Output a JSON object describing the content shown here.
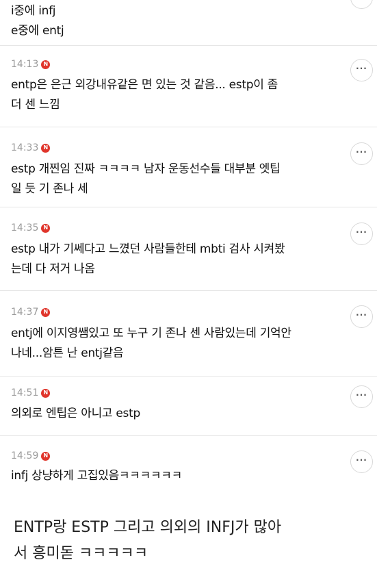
{
  "comments": [
    {
      "time": "",
      "text": "i중에 infj\ne중에 entj",
      "more": "···"
    },
    {
      "time": "14:13",
      "text": "entp은 은근 외강내유같은 면 있는 것 같음... estp이 좀\n더 센 느낌",
      "more": "···"
    },
    {
      "time": "14:33",
      "text": "estp 개찐임 진짜 ㅋㅋㅋㅋ 남자 운동선수들 대부분 엣팁\n일 듯 기 존나 세",
      "more": "···"
    },
    {
      "time": "14:35",
      "text": "estp 내가 기쎄다고 느꼈던 사람들한테 mbti 검사 시켜봤\n는데 다 저거 나옴",
      "more": "···"
    },
    {
      "time": "14:37",
      "text": "entj에 이지영쌤있고 또 누구 기 존나 센 사람있는데 기억안\n나네...암튼 난 entj같음",
      "more": "···"
    },
    {
      "time": "14:51",
      "text": "의외로 엔팁은 아니고 estp",
      "more": "···"
    },
    {
      "time": "14:59",
      "text": "infj 상냥하게 고집있음ㅋㅋㅋㅋㅋㅋ",
      "more": "···"
    }
  ],
  "badge_letter": "N",
  "caption": "ENTP랑 ESTP 그리고 의외의 INFJ가 많아\n서 흥미돋 ㅋㅋㅋㅋㅋ",
  "colors": {
    "badge": "#e0352b",
    "divider": "#e6e6e6",
    "meta": "#9a9a9a"
  }
}
